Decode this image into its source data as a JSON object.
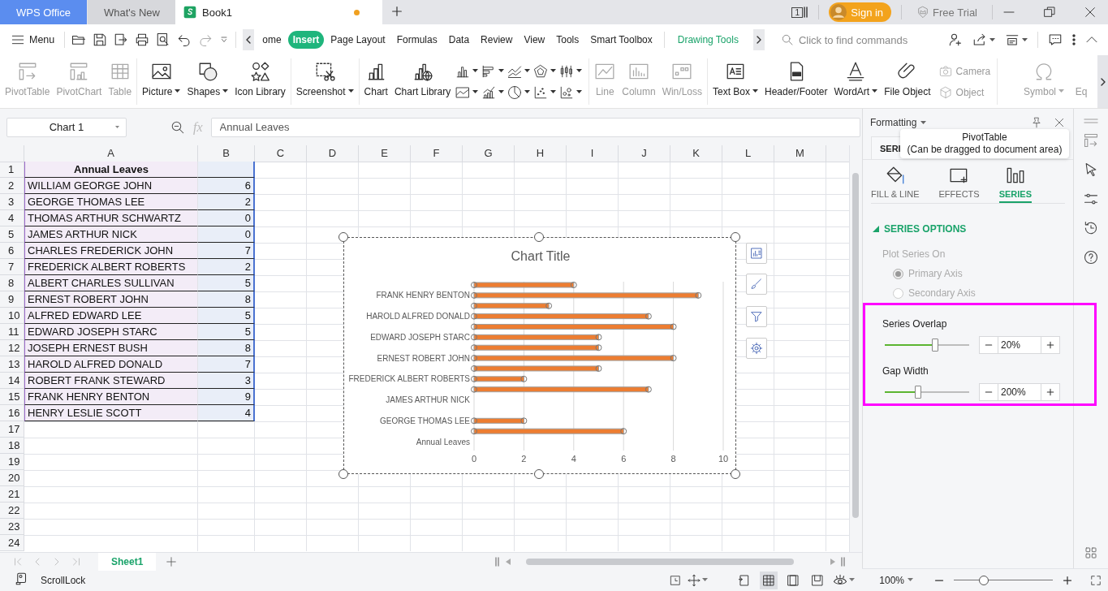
{
  "title_bar": {
    "tabs": [
      {
        "label": "WPS Office",
        "kind": "home",
        "selected": false
      },
      {
        "label": "What's New",
        "kind": "page",
        "selected": false
      },
      {
        "label": "Book1",
        "kind": "sheet",
        "selected": true,
        "unsaved": true
      }
    ],
    "window_count": "1",
    "sign_in": "Sign in",
    "free_trial": "Free Trial"
  },
  "menu": {
    "label": "Menu"
  },
  "ribbon_tabs": [
    {
      "label": "ome",
      "kind": "tab",
      "selected": false
    },
    {
      "label": "Insert",
      "kind": "tab",
      "selected": true
    },
    {
      "label": "Page Layout",
      "kind": "tab",
      "selected": false
    },
    {
      "label": "Formulas",
      "kind": "tab",
      "selected": false
    },
    {
      "label": "Data",
      "kind": "tab",
      "selected": false
    },
    {
      "label": "Review",
      "kind": "tab",
      "selected": false
    },
    {
      "label": "View",
      "kind": "tab",
      "selected": false
    },
    {
      "label": "Tools",
      "kind": "tab",
      "selected": false
    },
    {
      "label": "Smart Toolbox",
      "kind": "tab",
      "selected": false
    },
    {
      "label": "Drawing Tools",
      "kind": "contextual",
      "selected": false
    }
  ],
  "command_search": {
    "placeholder": "Click to find commands"
  },
  "ribbon_groups": [
    [
      {
        "kind": "large",
        "label": "PivotTable",
        "disabled": true,
        "dropdown": false
      },
      {
        "kind": "large",
        "label": "PivotChart",
        "disabled": true,
        "dropdown": false
      },
      {
        "kind": "large",
        "label": "Table",
        "disabled": true,
        "dropdown": false
      }
    ],
    [
      {
        "kind": "large",
        "label": "Picture",
        "disabled": false,
        "dropdown": true
      },
      {
        "kind": "large",
        "label": "Shapes",
        "disabled": false,
        "dropdown": true
      },
      {
        "kind": "large",
        "label": "Icon Library",
        "disabled": false,
        "dropdown": false
      }
    ],
    [
      {
        "kind": "large",
        "label": "Screenshot",
        "disabled": false,
        "dropdown": true
      }
    ],
    [
      {
        "kind": "large",
        "label": "Chart",
        "disabled": false,
        "dropdown": false
      },
      {
        "kind": "large",
        "label": "Chart Library",
        "disabled": false,
        "dropdown": false
      },
      {
        "kind": "chart_types",
        "disabled": false,
        "dropdown": true
      }
    ],
    [
      {
        "kind": "large",
        "label": "Line",
        "disabled": true,
        "dropdown": false
      },
      {
        "kind": "large",
        "label": "Column",
        "disabled": true,
        "dropdown": false
      },
      {
        "kind": "large",
        "label": "Win/Loss",
        "disabled": true,
        "dropdown": false
      }
    ],
    [
      {
        "kind": "large",
        "label": "Text Box",
        "disabled": false,
        "dropdown": true
      },
      {
        "kind": "large",
        "label": "Header/Footer",
        "disabled": false,
        "dropdown": false
      },
      {
        "kind": "large",
        "label": "WordArt",
        "disabled": false,
        "dropdown": true
      },
      {
        "kind": "large",
        "label": "File Object",
        "disabled": false,
        "dropdown": false
      },
      {
        "kind": "small",
        "disabled": true,
        "dropdown": false,
        "items": [
          {
            "label": "Camera"
          },
          {
            "label": "Object"
          }
        ]
      }
    ],
    [
      {
        "kind": "large",
        "label": "Symbol",
        "disabled": true,
        "dropdown": true
      },
      {
        "kind": "large",
        "label": "Eq",
        "disabled": true,
        "dropdown": false
      }
    ]
  ],
  "formula_bar": {
    "name_box": "Chart 1",
    "function_label": "fx",
    "formula": "Annual Leaves"
  },
  "sheet": {
    "columns": [
      "A",
      "B",
      "C",
      "D",
      "E",
      "F",
      "G",
      "H",
      "I",
      "J",
      "K",
      "L",
      "M"
    ],
    "rows": [
      {
        "number": "1",
        "kind": "header",
        "selected": true,
        "cells": [
          "Annual Leaves"
        ]
      },
      {
        "number": "2",
        "kind": "data",
        "selected": true,
        "cells": [
          "WILLIAM GEORGE JOHN",
          "6"
        ]
      },
      {
        "number": "3",
        "kind": "data",
        "selected": true,
        "cells": [
          "GEORGE THOMAS LEE",
          "2"
        ]
      },
      {
        "number": "4",
        "kind": "data",
        "selected": true,
        "cells": [
          "THOMAS ARTHUR SCHWARTZ",
          "0"
        ]
      },
      {
        "number": "5",
        "kind": "data",
        "selected": true,
        "cells": [
          "JAMES ARTHUR NICK",
          "0"
        ]
      },
      {
        "number": "6",
        "kind": "data",
        "selected": true,
        "cells": [
          "CHARLES FREDERICK JOHN",
          "7"
        ]
      },
      {
        "number": "7",
        "kind": "data",
        "selected": true,
        "cells": [
          "FREDERICK ALBERT ROBERTS",
          "2"
        ]
      },
      {
        "number": "8",
        "kind": "data",
        "selected": true,
        "cells": [
          "ALBERT CHARLES SULLIVAN",
          "5"
        ]
      },
      {
        "number": "9",
        "kind": "data",
        "selected": true,
        "cells": [
          "ERNEST ROBERT JOHN",
          "8"
        ]
      },
      {
        "number": "10",
        "kind": "data",
        "selected": true,
        "cells": [
          "ALFRED EDWARD LEE",
          "5"
        ]
      },
      {
        "number": "11",
        "kind": "data",
        "selected": true,
        "cells": [
          "EDWARD JOSEPH STARC",
          "5"
        ]
      },
      {
        "number": "12",
        "kind": "data",
        "selected": true,
        "cells": [
          "JOSEPH ERNEST BUSH",
          "8"
        ]
      },
      {
        "number": "13",
        "kind": "data",
        "selected": true,
        "cells": [
          "HAROLD ALFRED DONALD",
          "7"
        ]
      },
      {
        "number": "14",
        "kind": "data",
        "selected": true,
        "cells": [
          "ROBERT FRANK STEWARD",
          "3"
        ]
      },
      {
        "number": "15",
        "kind": "data",
        "selected": true,
        "cells": [
          "FRANK HENRY BENTON",
          "9"
        ]
      },
      {
        "number": "16",
        "kind": "data",
        "selected": true,
        "cells": [
          "HENRY LESLIE SCOTT",
          "4"
        ]
      },
      {
        "number": "17",
        "kind": "blank",
        "selected": false
      },
      {
        "number": "18",
        "kind": "blank",
        "selected": false
      },
      {
        "number": "19",
        "kind": "blank",
        "selected": false
      },
      {
        "number": "20",
        "kind": "blank",
        "selected": false
      },
      {
        "number": "21",
        "kind": "blank",
        "selected": false
      },
      {
        "number": "22",
        "kind": "blank",
        "selected": false
      },
      {
        "number": "23",
        "kind": "blank",
        "selected": false
      },
      {
        "number": "24",
        "kind": "blank",
        "selected": false
      }
    ]
  },
  "chart": {
    "selected": true,
    "chart_data": {
      "type": "bar",
      "orientation": "horizontal",
      "title": "Chart Title",
      "categories": [
        null,
        "FRANK HENRY BENTON",
        null,
        "HAROLD ALFRED DONALD",
        null,
        "EDWARD JOSEPH STARC",
        null,
        "ERNEST ROBERT JOHN",
        null,
        "FREDERICK ALBERT ROBERTS",
        null,
        "JAMES ARTHUR NICK",
        null,
        "GEORGE THOMAS LEE",
        null,
        "Annual Leaves"
      ],
      "series": [
        {
          "color": "#ed7d31",
          "values": [
            4,
            9,
            3,
            7,
            8,
            5,
            5,
            8,
            5,
            2,
            7,
            0,
            0,
            2,
            6,
            null
          ]
        }
      ],
      "xlim": [
        0,
        10
      ],
      "xticks": [
        0,
        2,
        4,
        6,
        8,
        10
      ],
      "grid": true
    }
  },
  "format_pane": {
    "title": "Formatting",
    "top_tab": "SERI",
    "tooltip": {
      "title": "PivotTable",
      "text": "(Can be dragged to document area)"
    },
    "tabs": [
      {
        "label": "FILL & LINE",
        "selected": false
      },
      {
        "label": "EFFECTS",
        "selected": false
      },
      {
        "label": "SERIES",
        "selected": true
      }
    ],
    "section": {
      "label": "SERIES OPTIONS",
      "expanded": true
    },
    "plot_series_on": {
      "label": "Plot Series On",
      "disabled": true,
      "options": [
        {
          "label": "Primary Axis",
          "selected": true
        },
        {
          "label": "Secondary Axis",
          "selected": false
        }
      ]
    },
    "settings_highlighted": true,
    "settings": [
      {
        "label": "Series Overlap",
        "level": 0.6,
        "value": "20%"
      },
      {
        "label": "Gap Width",
        "level": 0.39,
        "value": "200%"
      }
    ]
  },
  "sheet_tabs": [
    {
      "label": "Sheet1",
      "selected": true
    }
  ],
  "status_bar": {
    "text": "ScrollLock",
    "view_modes": [
      {
        "selected": false
      },
      {
        "selected": true
      },
      {
        "selected": false
      },
      {
        "selected": false
      }
    ],
    "zoom": "100%",
    "zoom_slider": {
      "level": 0.3
    }
  }
}
